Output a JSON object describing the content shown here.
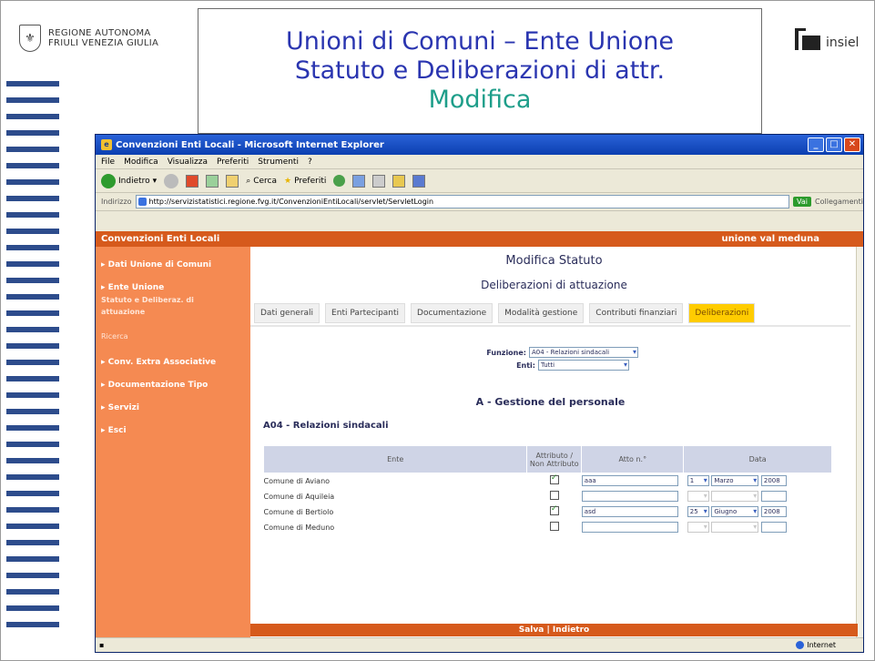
{
  "slide": {
    "logo_left": [
      "REGIONE AUTONOMA",
      "FRIULI VENEZIA GIULIA"
    ],
    "title_line1": "Unioni di Comuni – Ente Unione",
    "title_line2": "Statuto e Deliberazioni di attr.",
    "title_line3": "Modifica",
    "logo_right": "insiel"
  },
  "browser": {
    "window_title": "Convenzioni Enti Locali - Microsoft Internet Explorer",
    "menu": [
      "File",
      "Modifica",
      "Visualizza",
      "Preferiti",
      "Strumenti",
      "?"
    ],
    "toolbar": {
      "back": "Indietro",
      "search": "Cerca",
      "favorites": "Preferiti"
    },
    "address_label": "Indirizzo",
    "address_url": "http://servizistatistici.regione.fvg.it/ConvenzioniEntiLocali/servlet/ServletLogin",
    "go": "Vai",
    "links": "Collegamenti",
    "status_zone": "Internet"
  },
  "app": {
    "header_title": "Convenzioni Enti Locali",
    "user": "unione val meduna",
    "sidebar": {
      "dati_unione": "Dati Unione di Comuni",
      "ente_unione": "Ente Unione",
      "ente_sub1": "Statuto e Deliberaz. di",
      "ente_sub2": "attuazione",
      "ricerca": "Ricerca",
      "conv_extra": "Conv. Extra Associative",
      "doc_tipo": "Documentazione Tipo",
      "servizi": "Servizi",
      "esci": "Esci"
    },
    "page_title": "Modifica Statuto",
    "page_subtitle": "Deliberazioni di attuazione",
    "tabs": [
      "Dati generali",
      "Enti Partecipanti",
      "Documentazione",
      "Modalità gestione",
      "Contributi finanziari",
      "Deliberazioni"
    ],
    "form": {
      "funzione_label": "Funzione:",
      "funzione_value": "A04 - Relazioni sindacali",
      "enti_label": "Enti:",
      "enti_value": "Tutti"
    },
    "section_title": "A - Gestione del personale",
    "subsection_title": "A04 - Relazioni sindacali",
    "table": {
      "headers": [
        "Ente",
        "Attributo / Non Attributo",
        "Atto n.°",
        "Data"
      ],
      "rows": [
        {
          "ente": "Comune di Aviano",
          "attributo": true,
          "atto": "aaa",
          "day": "1",
          "month": "Marzo",
          "year": "2008"
        },
        {
          "ente": "Comune di Aquileia",
          "attributo": false,
          "atto": "",
          "day": "",
          "month": "",
          "year": ""
        },
        {
          "ente": "Comune di Bertiolo",
          "attributo": true,
          "atto": "asd",
          "day": "25",
          "month": "Giugno",
          "year": "2008"
        },
        {
          "ente": "Comune di Meduno",
          "attributo": false,
          "atto": "",
          "day": "",
          "month": "",
          "year": ""
        }
      ]
    },
    "footer": {
      "save": "Salva",
      "sep": "|",
      "back": "Indietro"
    }
  }
}
